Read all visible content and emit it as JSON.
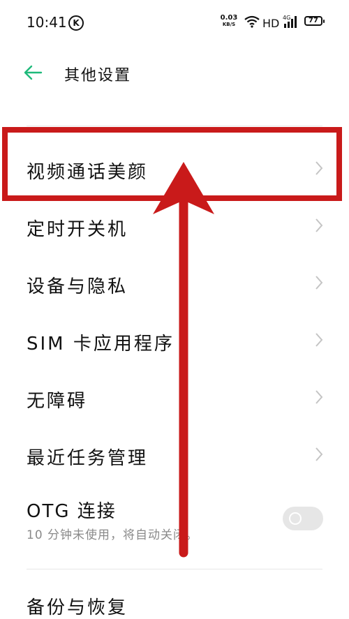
{
  "status_bar": {
    "time": "10:41",
    "k_badge": "K",
    "net_speed_value": "0.03",
    "net_speed_unit": "KB/S",
    "hd": "HD",
    "cell_label": "4G",
    "battery": "77"
  },
  "header": {
    "title": "其他设置"
  },
  "settings": [
    {
      "label": "视频通话美颜"
    },
    {
      "label": "定时开关机"
    },
    {
      "label": "设备与隐私"
    },
    {
      "label": "SIM 卡应用程序"
    },
    {
      "label": "无障碍"
    },
    {
      "label": "最近任务管理"
    }
  ],
  "otg": {
    "label": "OTG 连接",
    "sub": "10 分钟未使用，将自动关闭。",
    "enabled": false
  },
  "next_item_label": "备份与恢复",
  "colors": {
    "accent": "#1fba7b",
    "annotation": "#c91a1a",
    "toggle_off": "#e6e6e6"
  }
}
